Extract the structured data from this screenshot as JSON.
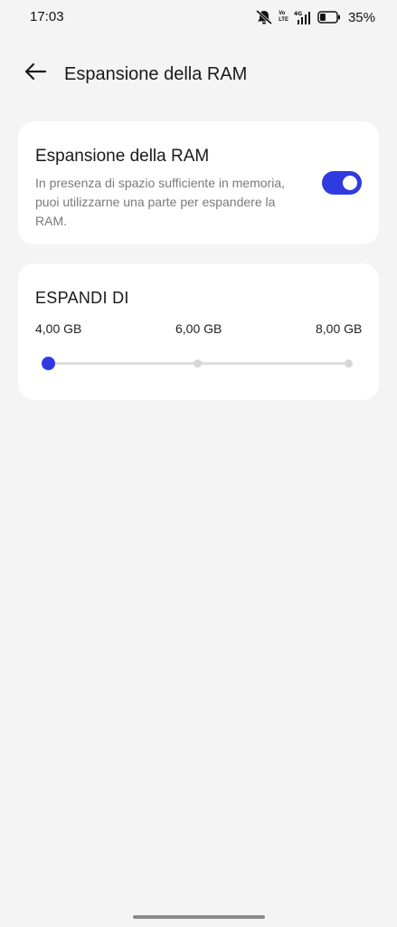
{
  "status_bar": {
    "time": "17:03",
    "network_top": "Vo",
    "network_bottom": "LTE",
    "battery_percent": "35%",
    "battery_level": 0.35,
    "icons": [
      "mute-bell-icon",
      "volte-icon",
      "4g-signal-icon",
      "battery-icon"
    ]
  },
  "header": {
    "title": "Espansione della RAM",
    "back_icon": "arrow-left-icon"
  },
  "ram_card": {
    "title": "Espansione della RAM",
    "description": "In presenza di spazio sufficiente in memoria, puoi utilizzarne una parte per espandere la RAM.",
    "toggle_on": true
  },
  "expand_card": {
    "title": "ESPANDI DI",
    "options": [
      "4,00 GB",
      "6,00 GB",
      "8,00 GB"
    ],
    "selected_index": 0
  },
  "colors": {
    "accent": "#2f3be0",
    "background": "#f4f4f4",
    "card": "#ffffff"
  }
}
